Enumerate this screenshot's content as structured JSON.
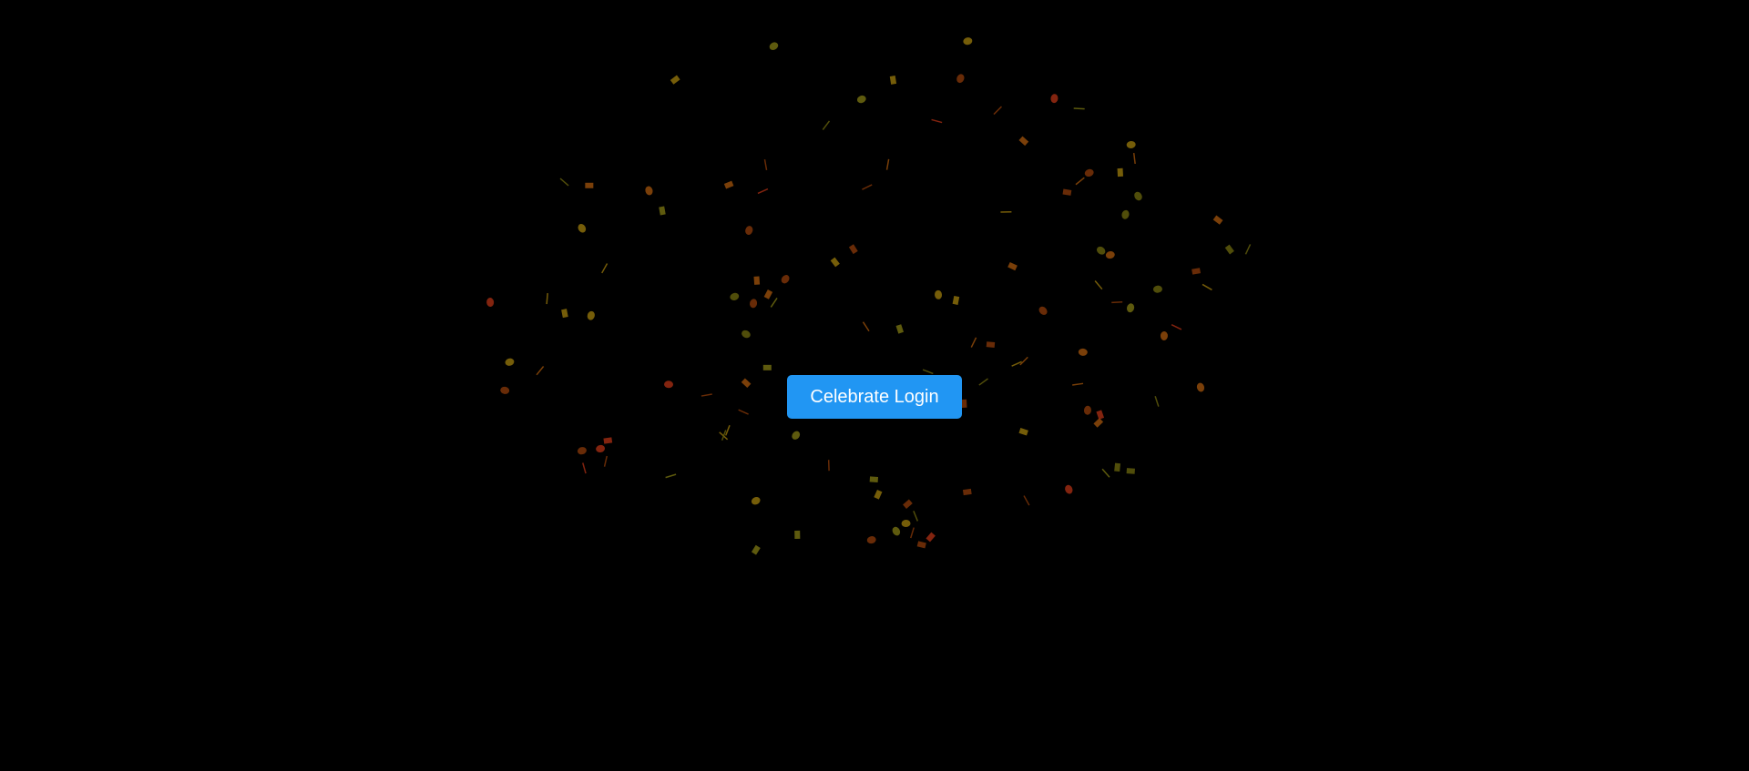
{
  "main": {
    "celebrate_button_label": "Celebrate Login"
  },
  "colors": {
    "background": "#000000",
    "button_bg": "#2196f3",
    "button_text": "#ffffff",
    "confetti_palette": [
      "#8a6d0b",
      "#7a3308",
      "#8f4a0a",
      "#6e6a10",
      "#9a2a12",
      "#5e5a0c"
    ]
  },
  "confetti": {
    "shapes": [
      "rect",
      "circle",
      "line"
    ],
    "count": 120
  }
}
